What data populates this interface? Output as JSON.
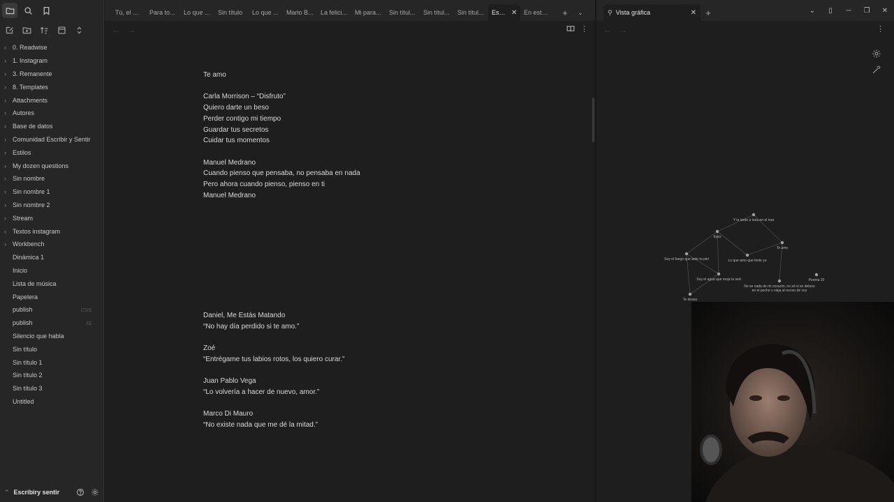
{
  "sidebar": {
    "tree": [
      {
        "label": "0. Readwise",
        "folder": true
      },
      {
        "label": "1. Instagram",
        "folder": true
      },
      {
        "label": "3. Remanente",
        "folder": true
      },
      {
        "label": "8. Templates",
        "folder": true
      },
      {
        "label": "Attachments",
        "folder": true
      },
      {
        "label": "Autores",
        "folder": true
      },
      {
        "label": "Base de datos",
        "folder": true
      },
      {
        "label": "Comunidad Escribir y Sentir",
        "folder": true
      },
      {
        "label": "Estilos",
        "folder": true
      },
      {
        "label": "My dozen questions",
        "folder": true
      },
      {
        "label": "Sin nombre",
        "folder": true
      },
      {
        "label": "Sin nombre 1",
        "folder": true
      },
      {
        "label": "Sin nombre 2",
        "folder": true
      },
      {
        "label": "Stream",
        "folder": true
      },
      {
        "label": "Textos instagram",
        "folder": true
      },
      {
        "label": "Workbench",
        "folder": true
      },
      {
        "label": "Dinámica 1",
        "folder": false
      },
      {
        "label": "Inicio",
        "folder": false
      },
      {
        "label": "Lista de música",
        "folder": false
      },
      {
        "label": "Papelera",
        "folder": false
      },
      {
        "label": "publish",
        "folder": false,
        "ext": "CSS"
      },
      {
        "label": "publish",
        "folder": false,
        "ext": "JS"
      },
      {
        "label": "Silencio que habla",
        "folder": false
      },
      {
        "label": "Sin título",
        "folder": false
      },
      {
        "label": "Sin título 1",
        "folder": false
      },
      {
        "label": "Sin título 2",
        "folder": false
      },
      {
        "label": "Sin título 3",
        "folder": false
      },
      {
        "label": "Untitled",
        "folder": false
      }
    ],
    "vault_name": "Escribiry sentir"
  },
  "tabs": [
    {
      "label": "Tú, el ai...",
      "active": false
    },
    {
      "label": "Para to...",
      "active": false
    },
    {
      "label": "Lo que ...",
      "active": false
    },
    {
      "label": "Sin título",
      "active": false
    },
    {
      "label": "Lo que ...",
      "active": false
    },
    {
      "label": "Mario B...",
      "active": false
    },
    {
      "label": "La felici...",
      "active": false
    },
    {
      "label": "Mi para...",
      "active": false
    },
    {
      "label": "Sin títul...",
      "active": false
    },
    {
      "label": "Sin títul...",
      "active": false
    },
    {
      "label": "Sin títul...",
      "active": false
    },
    {
      "label": "Escr...",
      "active": true
    },
    {
      "label": "En este ...",
      "active": false
    }
  ],
  "note": {
    "lines_top": [
      "Te amo",
      "",
      "Carla Morrison – “Disfruto”",
      "Quiero darte un beso",
      "Perder contigo mi tiempo",
      "Guardar tus secretos",
      "Cuidar tus momentos",
      "",
      "Manuel Medrano",
      "Cuando pienso que pensaba, no pensaba en nada",
      "Pero ahora cuando pienso, pienso en ti",
      "Manuel Medrano"
    ],
    "lines_bottom": [
      "Daniel, Me Estás Matando",
      "“No hay día perdido si te amo.”",
      "",
      "Zoé",
      "“Entrégame tus labios rotos, los quiero curar.”",
      "",
      "Juan Pablo Vega",
      "“Lo volvería a hacer de nuevo, amor.”",
      "",
      "Marco Di Mauro",
      "“No existe nada que me dé la mitad.”"
    ]
  },
  "graph_pane": {
    "tab_title": "Vista gráfica",
    "nodes": [
      {
        "label": "Y la tarde a luna en el mar"
      },
      {
        "label": "Eyes"
      },
      {
        "label": "Te amo"
      },
      {
        "label": "Soy el fuego que arde tu piel"
      },
      {
        "label": "Lo que amo que triste yo"
      },
      {
        "label": "Soy el agua que moja tu sed"
      },
      {
        "label": "Poema 20"
      },
      {
        "label": "No se nada de mi corazón, no sé si se detuvo en el pecho o viaja al recreo de voz"
      },
      {
        "label": "Te deseo"
      }
    ]
  },
  "icons": {
    "sidebar_top": [
      "folder-icon",
      "search-icon",
      "bookmark-icon"
    ],
    "nav_actions": [
      "new-note-icon",
      "new-folder-icon",
      "sort-icon",
      "collapse-icon",
      "expand-icon"
    ]
  }
}
